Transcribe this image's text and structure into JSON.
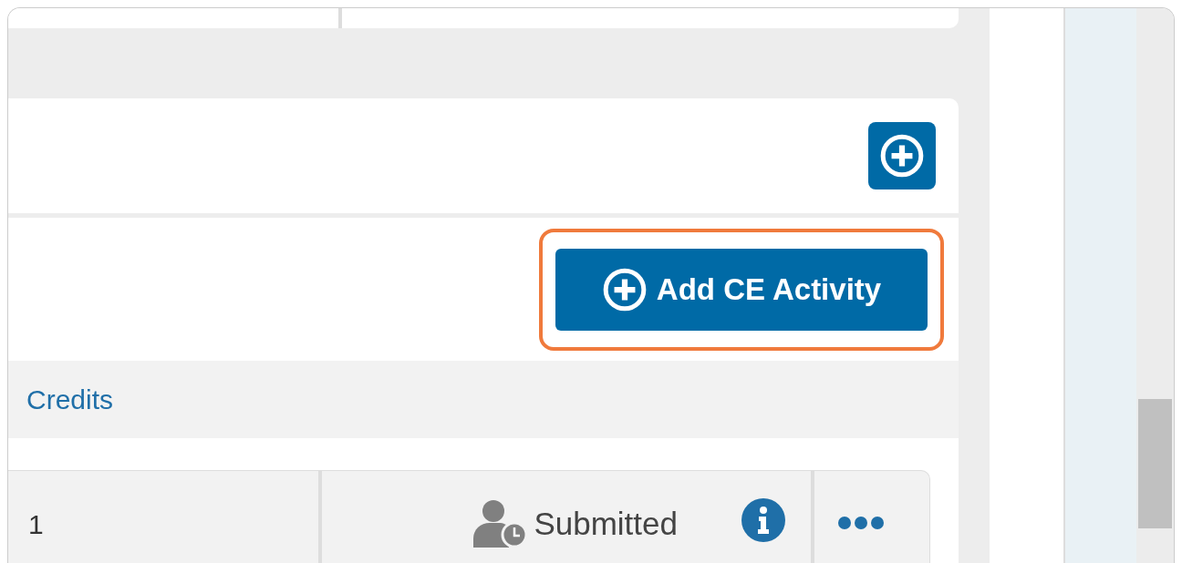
{
  "add_activity_button": {
    "label": "Add CE Activity",
    "highlighted": true
  },
  "table": {
    "columns": [
      "Credits"
    ],
    "rows": [
      {
        "credits": "1",
        "status": "Submitted"
      }
    ]
  }
}
